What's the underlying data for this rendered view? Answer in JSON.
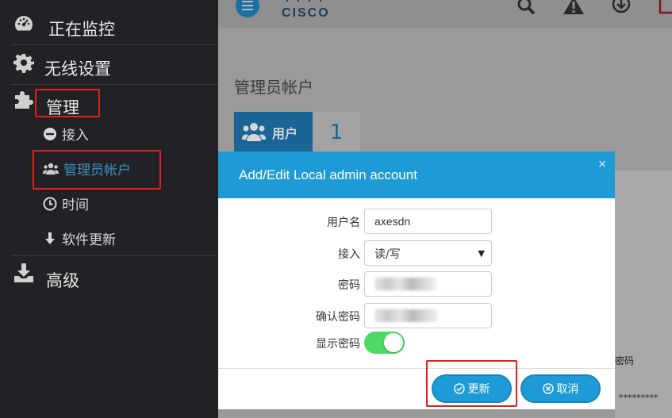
{
  "sidebar": {
    "monitor_label": "正在监控",
    "wireless_label": "无线设置",
    "management_label": "管理",
    "access_label": "接入",
    "admin_accounts_label": "管理员帐户",
    "time_label": "时间",
    "software_update_label": "软件更新",
    "advanced_label": "高级"
  },
  "header": {
    "brand": "CISCO"
  },
  "page": {
    "title": "管理员帐户",
    "users_tab_label": "用户",
    "users_count": "1",
    "password_col": "密码",
    "masked_password": "*********"
  },
  "modal": {
    "title": "Add/Edit Local admin account",
    "close": "×",
    "username_label": "用户名",
    "username_value": "axesdn",
    "access_label": "接入",
    "access_value": "读/写",
    "password_label": "密码",
    "confirm_label": "确认密码",
    "show_password_label": "显示密码",
    "show_password_on": true,
    "update_button": "更新",
    "cancel_button": "取消"
  },
  "colors": {
    "accent": "#1e9bd7",
    "highlight": "#e0201c",
    "toggle_on": "#4cd964",
    "sidebar_bg": "#222226"
  }
}
